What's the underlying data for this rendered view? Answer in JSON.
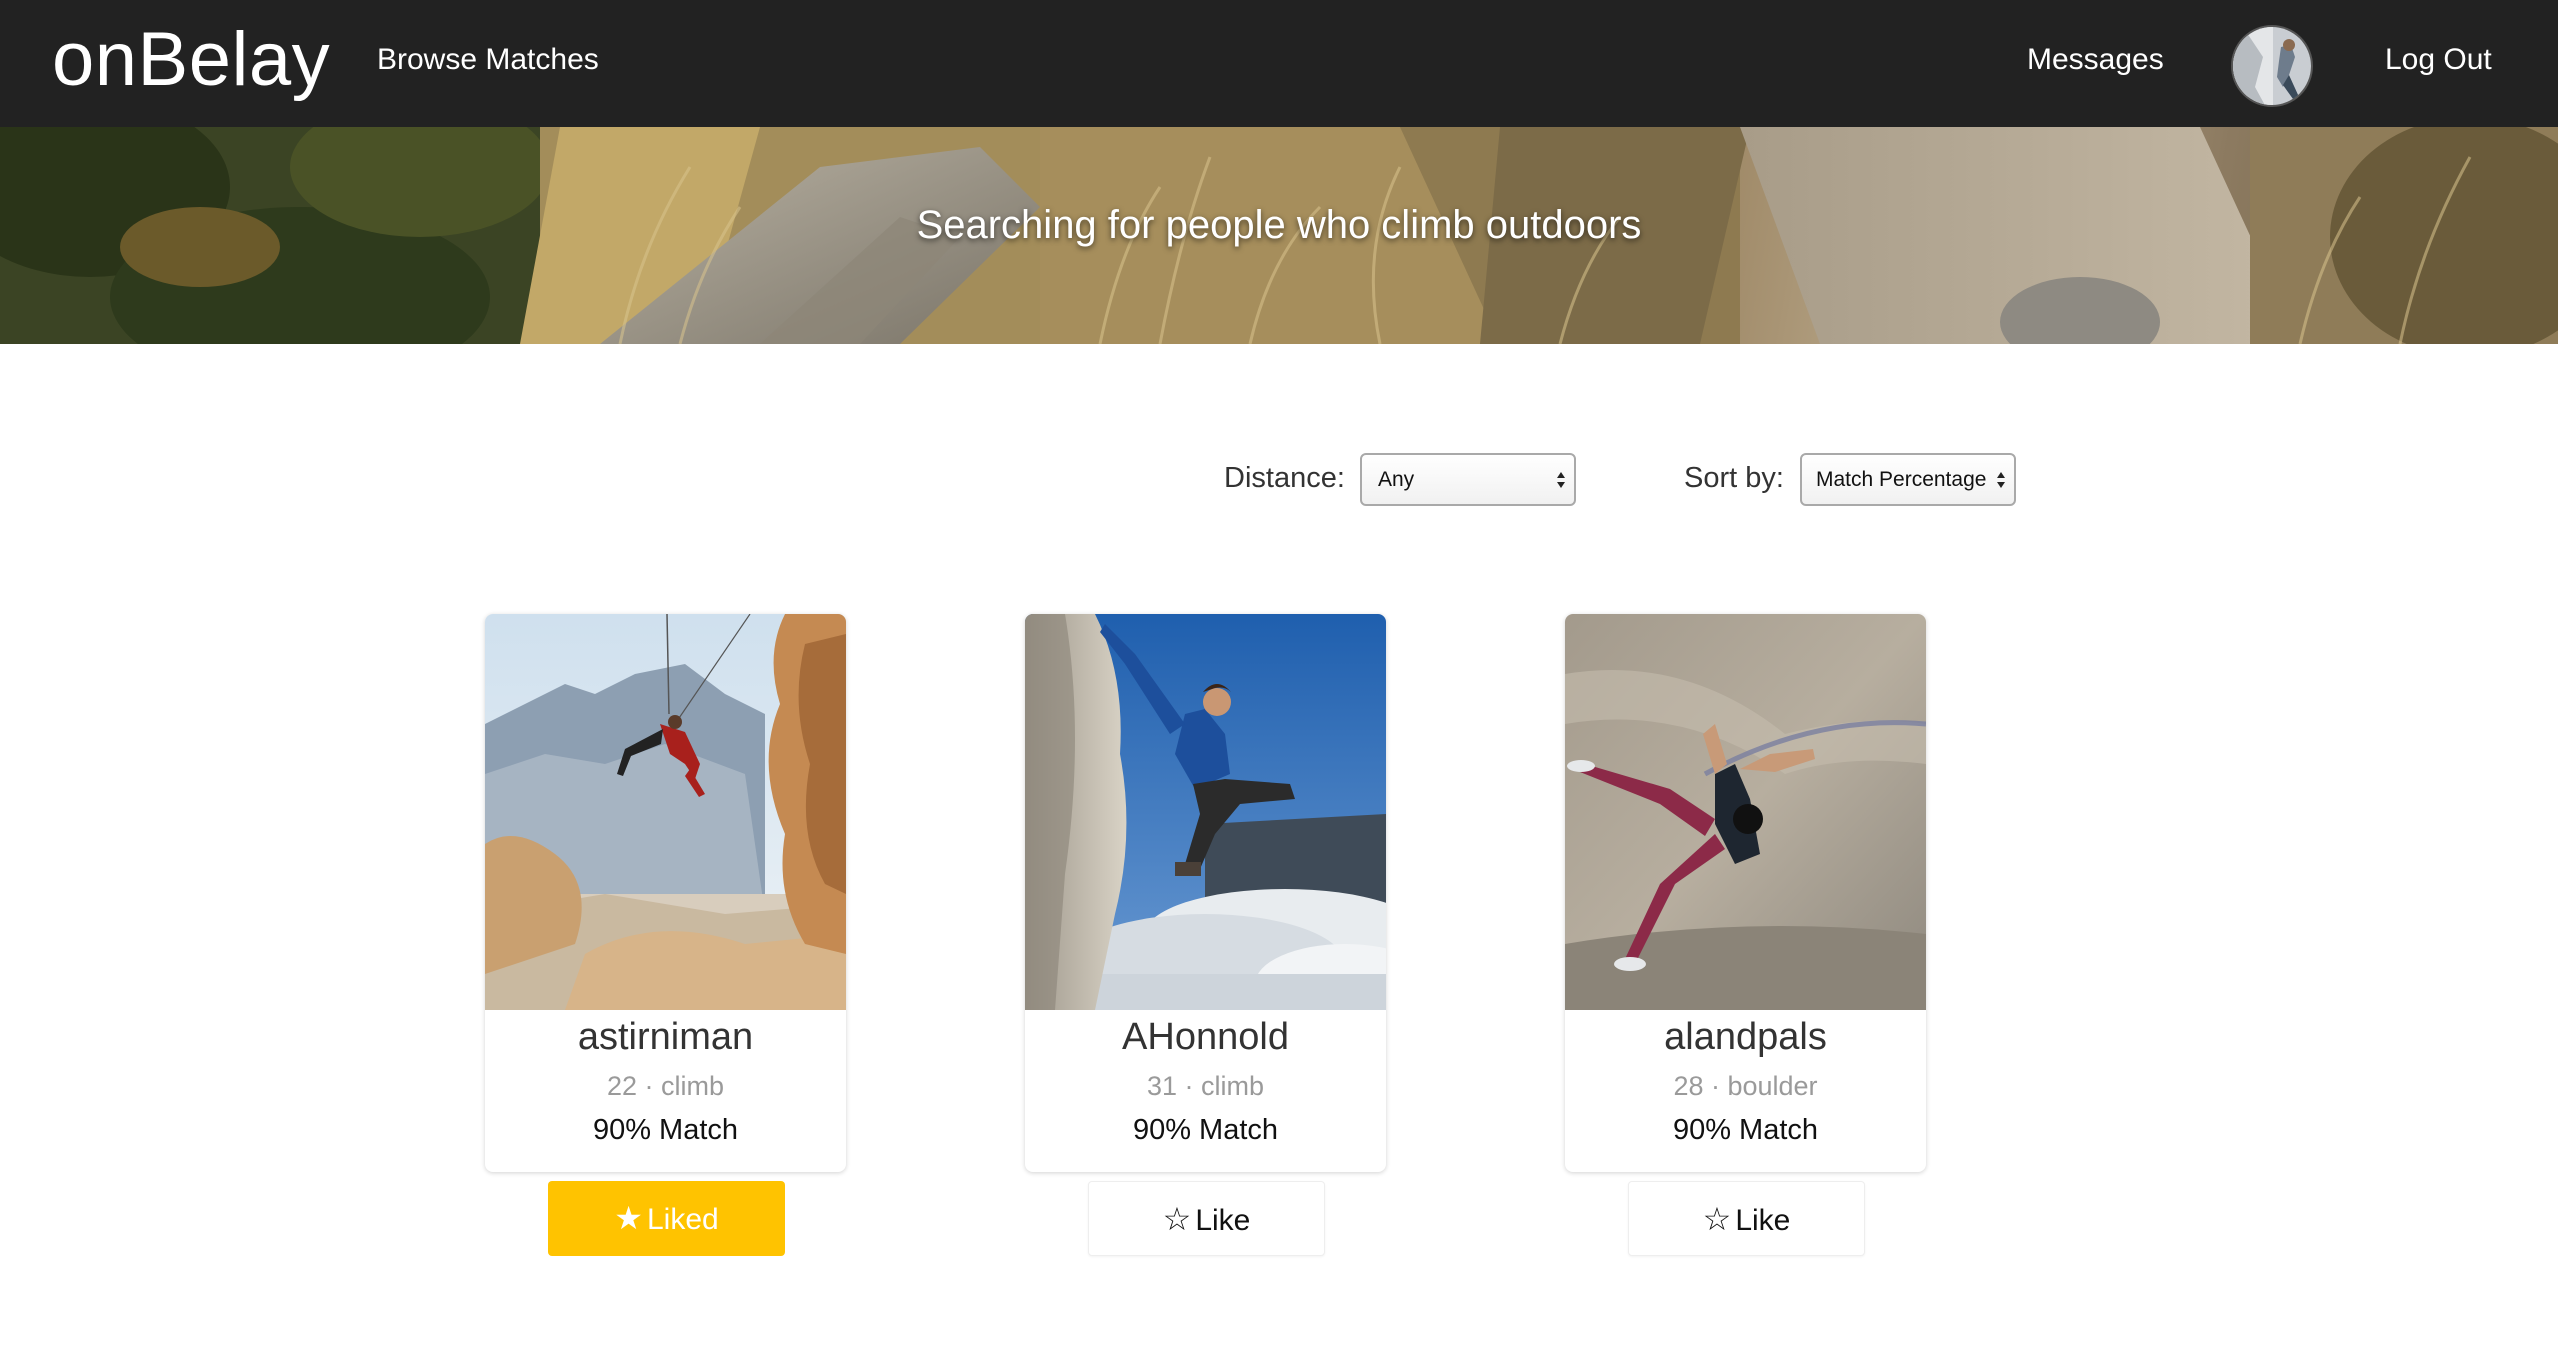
{
  "nav": {
    "brand": "onBelay",
    "browse": "Browse Matches",
    "messages": "Messages",
    "logout": "Log Out"
  },
  "hero": {
    "title": "Searching for people who climb outdoors"
  },
  "filters": {
    "distance_label": "Distance:",
    "distance_value": "Any",
    "sort_label": "Sort by:",
    "sort_value": "Match Percentage"
  },
  "matches": [
    {
      "name": "astirniman",
      "meta": "22 · climb",
      "match": "90% Match",
      "button": "Liked",
      "liked": true
    },
    {
      "name": "AHonnold",
      "meta": "31 · climb",
      "match": "90% Match",
      "button": "Like",
      "liked": false
    },
    {
      "name": "alandpals",
      "meta": "28 · boulder",
      "match": "90% Match",
      "button": "Like",
      "liked": false
    }
  ],
  "icons": {
    "liked": "star-filled-icon",
    "like": "star-outline-icon"
  },
  "colors": {
    "navbar": "#222222",
    "liked_button": "#ffc300",
    "text_muted": "#9a9a9a"
  }
}
